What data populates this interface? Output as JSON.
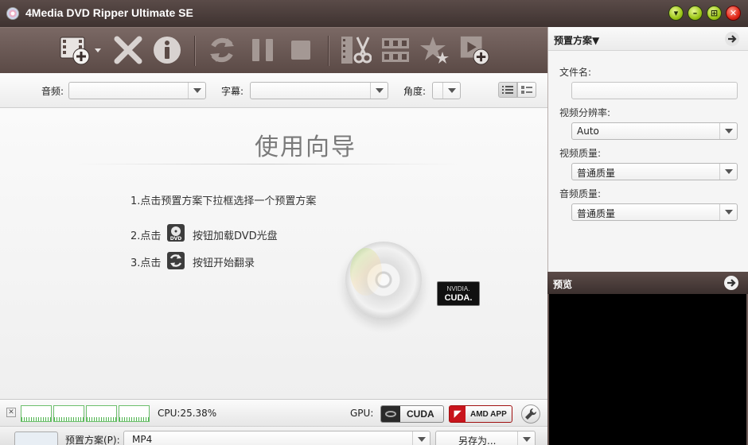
{
  "window": {
    "title": "4Media DVD Ripper Ultimate SE",
    "controls": [
      "minimize-to-tray",
      "minimize",
      "maximize",
      "close"
    ]
  },
  "toolbar": {
    "icons": [
      "add-file-icon",
      "remove-icon",
      "info-icon",
      "convert-icon",
      "pause-icon",
      "stop-icon",
      "clip-icon",
      "merge-icon",
      "effects-icon",
      "add-output-icon"
    ]
  },
  "subbar": {
    "audio_label": "音频:",
    "audio_value": "",
    "subtitle_label": "字幕:",
    "subtitle_value": "",
    "angle_label": "角度:",
    "angle_value": ""
  },
  "guide": {
    "title": "使用向导",
    "step1": "1.点击预置方案下拉框选择一个预置方案",
    "step2_prefix": "2.点击",
    "step2_suffix": "按钮加载DVD光盘",
    "step3_prefix": "3.点击",
    "step3_suffix": "按钮开始翻录",
    "dvd_icon_text": "DVD",
    "cuda_badge_line1": "NVIDIA.",
    "cuda_badge_line2": "CUDA."
  },
  "status": {
    "cpu": "CPU:25.38%",
    "gpu_label": "GPU:",
    "cuda_button": "CUDA",
    "amd_button": "AMD APP"
  },
  "profile": {
    "label": "预置方案(P):",
    "value": "MP4",
    "save_as": "另存为..."
  },
  "right_panel": {
    "header": "预置方案▼",
    "filename_label": "文件名:",
    "filename_value": "",
    "resolution_label": "视频分辨率:",
    "resolution_value": "Auto",
    "video_quality_label": "视频质量:",
    "video_quality_value": "普通质量",
    "audio_quality_label": "音频质量:",
    "audio_quality_value": "普通质量",
    "preview_header": "预览"
  },
  "colors": {
    "titlebar": "#4a3c39",
    "toolbar": "#6a5854",
    "accent_green": "#9cc618",
    "close_red": "#e02818",
    "amd_red": "#c8141c",
    "meter_green": "#4db44d"
  }
}
